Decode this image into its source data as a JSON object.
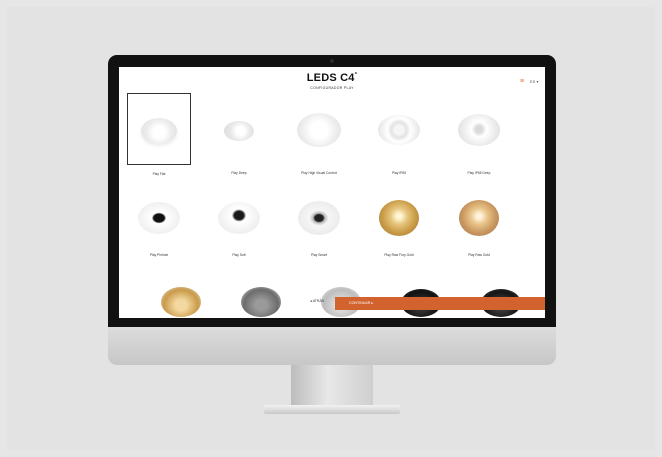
{
  "header": {
    "logo": "LEDS C4",
    "logo_mark": "°",
    "subtitle": "CONFIGURADOR PLAY",
    "menu_icon": "hamburger-icon",
    "language": "ES ▾",
    "accent_color": "#d2632f"
  },
  "products": [
    {
      "label": "Play Flat",
      "selected": true
    },
    {
      "label": "Play Deep",
      "selected": false
    },
    {
      "label": "Play High Visual Confort",
      "selected": false
    },
    {
      "label": "Play IP65",
      "selected": false
    },
    {
      "label": "Play IP65 Deep",
      "selected": false
    },
    {
      "label": "Play Pinhole",
      "selected": false
    },
    {
      "label": "Play Soft",
      "selected": false
    },
    {
      "label": "Play Smart",
      "selected": false
    },
    {
      "label": "Play Raw Fury Gold",
      "selected": false
    },
    {
      "label": "Play Raw Gold",
      "selected": false
    }
  ],
  "footer": {
    "back_label": "◂ ATRÁS",
    "continue_label": "CONTINUAR ▸"
  }
}
